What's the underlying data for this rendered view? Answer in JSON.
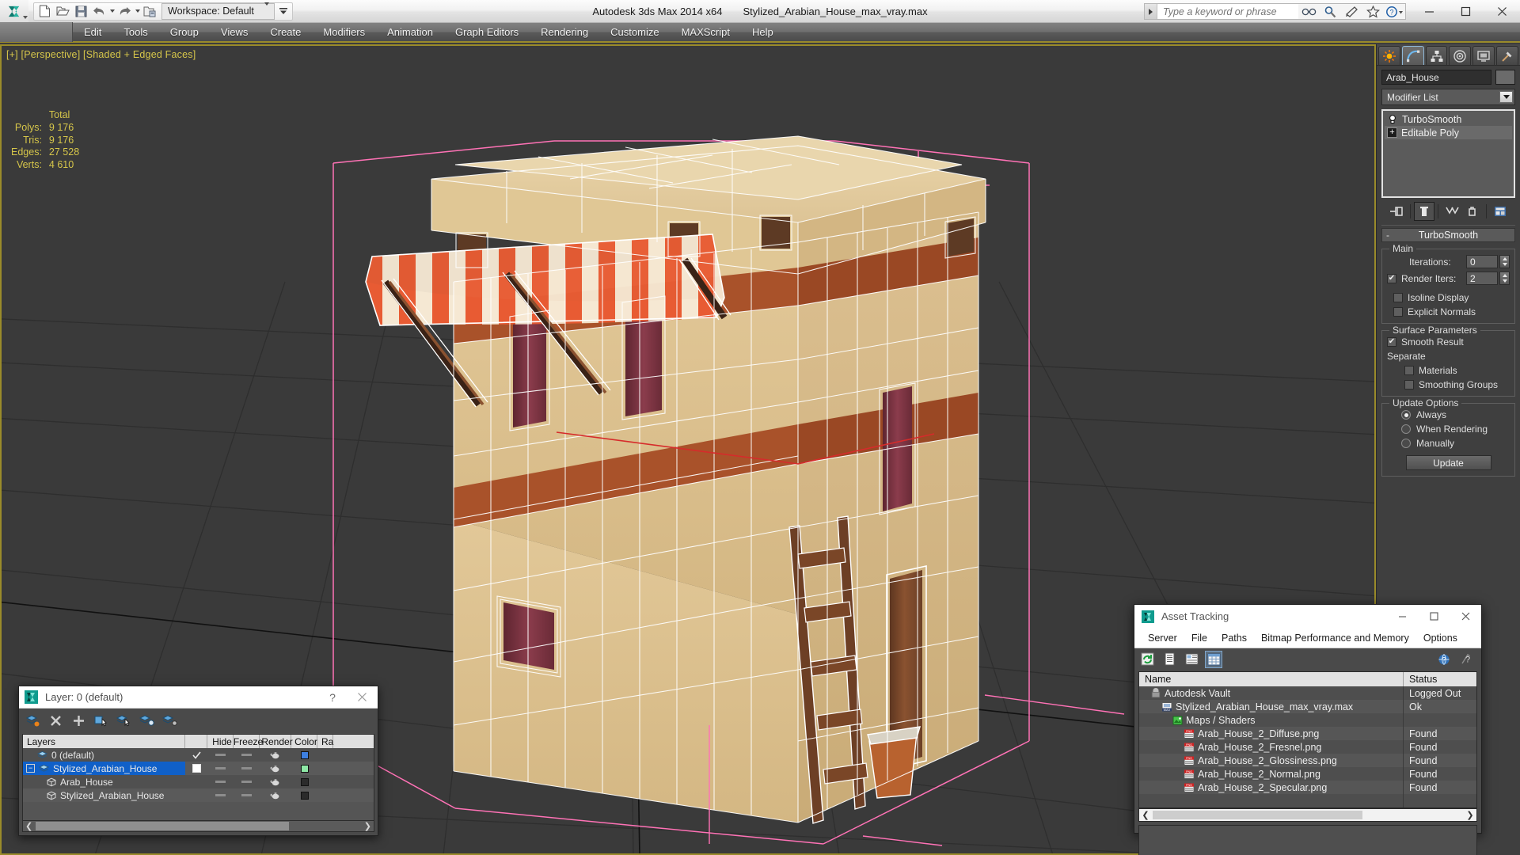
{
  "titlebar": {
    "app_title": "Autodesk 3ds Max  2014 x64",
    "document_title": "Stylized_Arabian_House_max_vray.max",
    "workspace_label": "Workspace: Default",
    "quick_access": [
      {
        "name": "new-file-icon",
        "label": "New"
      },
      {
        "name": "open-file-icon",
        "label": "Open"
      },
      {
        "name": "save-file-icon",
        "label": "Save"
      },
      {
        "name": "undo-icon",
        "label": "Undo"
      },
      {
        "name": "redo-icon",
        "label": "Redo"
      },
      {
        "name": "set-project-folder-icon",
        "label": "Set Project Folder"
      }
    ],
    "infocenter": {
      "placeholder": "Type a keyword or phrase",
      "buttons": [
        "search-icon",
        "subscription-center-icon",
        "communication-center-icon",
        "favorites-icon",
        "help-icon"
      ]
    },
    "window_controls": [
      "minimize",
      "maximize",
      "close"
    ]
  },
  "menubar": {
    "items": [
      "Edit",
      "Tools",
      "Group",
      "Views",
      "Create",
      "Modifiers",
      "Animation",
      "Graph Editors",
      "Rendering",
      "Customize",
      "MAXScript",
      "Help"
    ]
  },
  "viewport": {
    "label": "[+] [Perspective] [Shaded + Edged Faces]",
    "stats": {
      "header": "Total",
      "rows": [
        {
          "label": "Polys:",
          "value": "9 176"
        },
        {
          "label": "Tris:",
          "value": "9 176"
        },
        {
          "label": "Edges:",
          "value": "27 528"
        },
        {
          "label": "Verts:",
          "value": "4 610"
        }
      ]
    },
    "colors": {
      "background": "#3a3a3a",
      "grid": "#2d2d2d",
      "wireframe": "#ffffff",
      "wall": "#d9bd88",
      "wall_shadow": "#c4a776",
      "trim": "#a9522a",
      "awning_stripe": "#e8552f",
      "awning_base": "#f4e3cd",
      "window_glass": "#7a3240",
      "wood": "#7b452a",
      "gizmo_pink": "#ff72b6",
      "axis_red": "#d62b2b",
      "roof_top": "#e4cb9d"
    }
  },
  "command_panel": {
    "tabs": [
      {
        "name": "create-tab",
        "icon": "create-star-icon"
      },
      {
        "name": "modify-tab",
        "icon": "modify-curve-icon",
        "active": true
      },
      {
        "name": "hierarchy-tab",
        "icon": "hierarchy-icon"
      },
      {
        "name": "motion-tab",
        "icon": "motion-wheel-icon"
      },
      {
        "name": "display-tab",
        "icon": "display-monitor-icon"
      },
      {
        "name": "utilities-tab",
        "icon": "utilities-hammer-icon"
      }
    ],
    "object_name": "Arab_House",
    "modifier_list_label": "Modifier List",
    "modifier_stack": [
      {
        "label": "TurboSmooth",
        "icon": "lightbulb-icon",
        "selected": false
      },
      {
        "label": "Editable Poly",
        "icon": "plus-expand-icon",
        "selected": true
      }
    ],
    "stack_tools": [
      "pin-stack-icon",
      "show-end-result-icon",
      "make-unique-icon",
      "remove-modifier-icon",
      "configure-modifier-sets-icon"
    ],
    "rollout": {
      "title": "TurboSmooth",
      "collapse_glyph": "-",
      "groups": [
        {
          "title": "Main",
          "fields": [
            {
              "type": "spinner",
              "label": "Iterations:",
              "value": "0",
              "checkbox": null
            },
            {
              "type": "spinner",
              "label": "Render Iters:",
              "value": "2",
              "checkbox": true
            },
            {
              "type": "checkbox",
              "label": "Isoline Display",
              "checked": false
            },
            {
              "type": "checkbox",
              "label": "Explicit Normals",
              "checked": false
            }
          ]
        },
        {
          "title": "Surface Parameters",
          "fields": [
            {
              "type": "checkbox",
              "label": "Smooth Result",
              "checked": true
            },
            {
              "type": "static",
              "label": "Separate"
            },
            {
              "type": "checkbox",
              "label": "Materials",
              "checked": false,
              "indent": true
            },
            {
              "type": "checkbox",
              "label": "Smoothing Groups",
              "checked": false,
              "indent": true
            }
          ]
        },
        {
          "title": "Update Options",
          "fields": [
            {
              "type": "radio",
              "label": "Always",
              "checked": true
            },
            {
              "type": "radio",
              "label": "When Rendering",
              "checked": false
            },
            {
              "type": "radio",
              "label": "Manually",
              "checked": false
            }
          ],
          "button": "Update"
        }
      ]
    }
  },
  "layer_dialog": {
    "title": "Layer: 0 (default)",
    "help_glyph": "?",
    "toolbar": [
      "create-new-layer-icon",
      "delete-layer-icon",
      "add-to-layer-icon",
      "select-objects-in-layer-icon",
      "highlight-selected-objects-icon",
      "hide-unhide-layer-icon",
      "layer-properties-icon"
    ],
    "columns": [
      "Layers",
      "",
      "Hide",
      "Freeze",
      "Render",
      "Color",
      "Ra"
    ],
    "rows": [
      {
        "name": "0 (default)",
        "icon": "layer-icon",
        "indent": 0,
        "check": "check",
        "hide": "dash",
        "freeze": "dash",
        "render": "teapot",
        "color": "#3d7fe0",
        "selected": false,
        "expander": null
      },
      {
        "name": "Stylized_Arabian_House",
        "icon": "layer-icon",
        "indent": 0,
        "check": "box",
        "hide": "dash",
        "freeze": "dash",
        "render": "teapot",
        "color": "#8ee8a6",
        "selected": true,
        "expander": "minus"
      },
      {
        "name": "Arab_House",
        "icon": "object-icon",
        "indent": 1,
        "check": "",
        "hide": "dash",
        "freeze": "dash",
        "render": "teapot",
        "color": "#2b2b2b",
        "selected": false,
        "expander": null
      },
      {
        "name": "Stylized_Arabian_House",
        "icon": "object-icon",
        "indent": 1,
        "check": "",
        "hide": "dash",
        "freeze": "dash",
        "render": "teapot",
        "color": "#2b2b2b",
        "selected": false,
        "expander": null
      }
    ],
    "scroll": {
      "left_glyph": "❮",
      "right_glyph": "❯"
    }
  },
  "asset_tracking": {
    "title": "Asset Tracking",
    "menu": [
      "Server",
      "File",
      "Paths",
      "Bitmap Performance and Memory",
      "Options"
    ],
    "toolbar_left": [
      "refresh-icon",
      "list-view-icon",
      "details-view-icon",
      "grid-view-icon"
    ],
    "toolbar_right": [
      "help-globe-icon",
      "whats-this-icon"
    ],
    "columns": {
      "name": "Name",
      "status": "Status"
    },
    "rows": [
      {
        "name": "Autodesk Vault",
        "status": "Logged Out",
        "indent": 0,
        "icon": "vault-icon"
      },
      {
        "name": "Stylized_Arabian_House_max_vray.max",
        "status": "Ok",
        "indent": 1,
        "icon": "max-file-icon"
      },
      {
        "name": "Maps / Shaders",
        "status": "",
        "indent": 2,
        "icon": "maps-shaders-icon"
      },
      {
        "name": "Arab_House_2_Diffuse.png",
        "status": "Found",
        "indent": 3,
        "icon": "png-file-icon"
      },
      {
        "name": "Arab_House_2_Fresnel.png",
        "status": "Found",
        "indent": 3,
        "icon": "png-file-icon"
      },
      {
        "name": "Arab_House_2_Glossiness.png",
        "status": "Found",
        "indent": 3,
        "icon": "png-file-icon"
      },
      {
        "name": "Arab_House_2_Normal.png",
        "status": "Found",
        "indent": 3,
        "icon": "png-file-icon"
      },
      {
        "name": "Arab_House_2_Specular.png",
        "status": "Found",
        "indent": 3,
        "icon": "png-file-icon"
      },
      {
        "name": "",
        "status": "",
        "indent": 0,
        "icon": ""
      }
    ],
    "scroll": {
      "left_glyph": "❮",
      "right_glyph": "❯"
    }
  }
}
